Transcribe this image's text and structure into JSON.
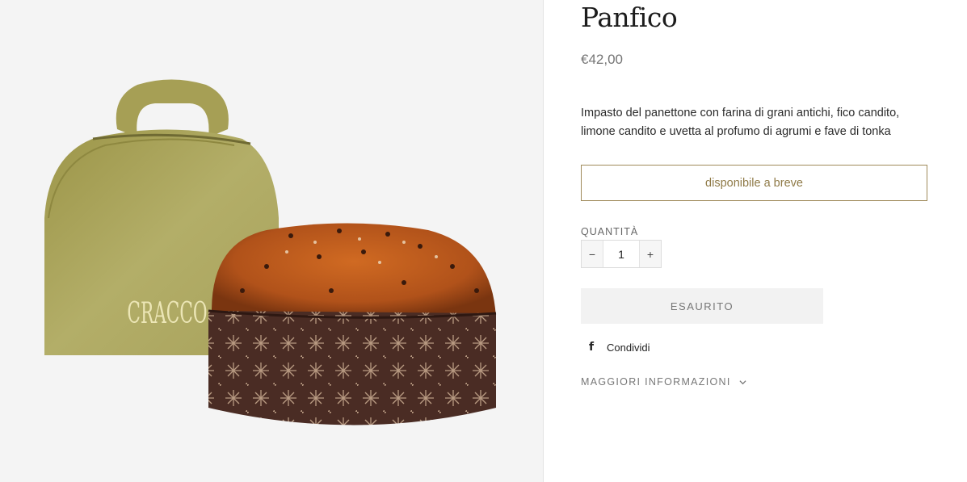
{
  "product": {
    "title": "Panfico",
    "price": "€42,00",
    "description": "Impasto del panettone con farina di grani antichi, fico candito, limone candito e uvetta al profumo di agrumi e fave di tonka",
    "availability_label": "disponibile a breve",
    "image_alt": "Panettone Panfico con scatola CRACCO",
    "box_brand": "CRACCO"
  },
  "quantity": {
    "label": "QUANTITÀ",
    "value": "1",
    "decrement": "−",
    "increment": "+"
  },
  "actions": {
    "soldout_label": "ESAURITO",
    "share_icon": "f",
    "share_label": "Condividi",
    "more_info_label": "MAGGIORI INFORMAZIONI"
  },
  "colors": {
    "accent": "#8f7a47",
    "box_gold": "#a9a35a",
    "crust": "#c0601c",
    "wrapper": "#4a2c24"
  }
}
